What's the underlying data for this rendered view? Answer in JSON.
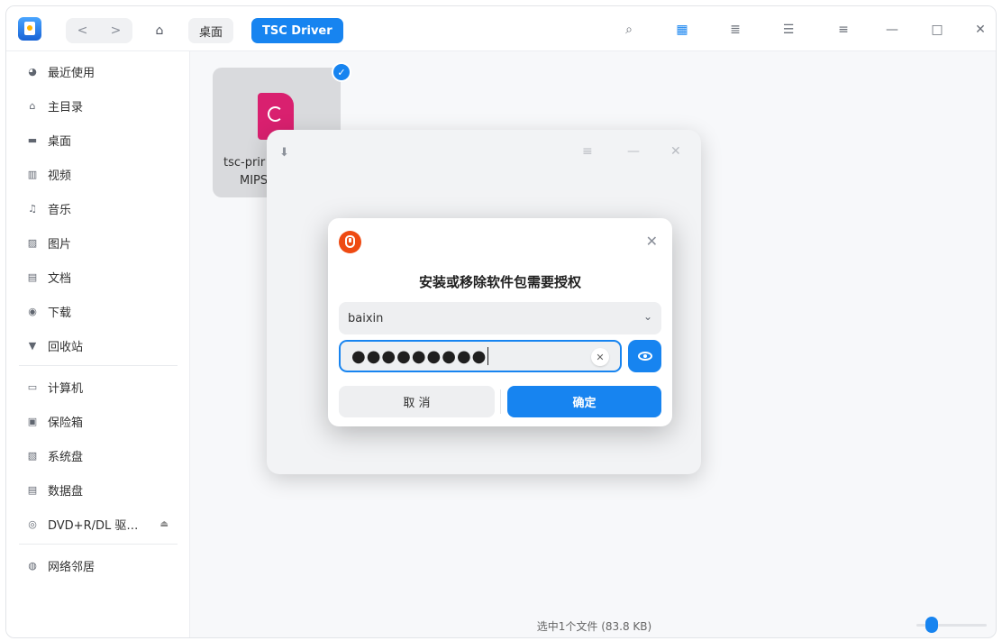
{
  "titlebar": {
    "back_icon": "<",
    "forward_icon": ">",
    "home_icon": "⌂",
    "breadcrumbs": [
      {
        "label": "桌面"
      },
      {
        "label": "TSC Driver"
      }
    ],
    "search_icon": "⌕",
    "icon_view_icon": "▦",
    "list_view_icon": "≣",
    "detail_view_icon": "☰",
    "menu_icon": "≡",
    "minimize_icon": "—",
    "maximize_icon": "□",
    "close_icon": "✕"
  },
  "sidebar": {
    "items": [
      {
        "label": "最近使用",
        "icon": "◕"
      },
      {
        "label": "主目录",
        "icon": "⌂"
      },
      {
        "label": "桌面",
        "icon": "▬"
      },
      {
        "label": "视频",
        "icon": "▥"
      },
      {
        "label": "音乐",
        "icon": "♫"
      },
      {
        "label": "图片",
        "icon": "▨"
      },
      {
        "label": "文档",
        "icon": "▤"
      },
      {
        "label": "下载",
        "icon": "◉"
      },
      {
        "label": "回收站",
        "icon": "▼"
      },
      {
        "label": "计算机",
        "icon": "▭"
      },
      {
        "label": "保险箱",
        "icon": "▣"
      },
      {
        "label": "系统盘",
        "icon": "▧"
      },
      {
        "label": "数据盘",
        "icon": "▤"
      },
      {
        "label": "DVD+R/DL 驱…",
        "icon": "◎"
      },
      {
        "label": "网络邻居",
        "icon": "◍"
      }
    ],
    "eject_icon": "⏏"
  },
  "content": {
    "file": {
      "name_line1": "tsc-prir",
      "name_line2": "MIPS",
      "check_icon": "✓"
    },
    "status": "选中1个文件 (83.8 KB)"
  },
  "installer": {
    "download_icon": "⬇",
    "menu_icon": "≡",
    "minimize_icon": "—",
    "close_icon": "✕"
  },
  "auth_dialog": {
    "title": "安装或移除软件包需要授权",
    "close_icon": "✕",
    "user": "baixin",
    "chevron": "⌄",
    "password_mask": "●●●●●●●●●",
    "clear_icon": "✕",
    "cancel_label": "取 消",
    "ok_label": "确定"
  },
  "colors": {
    "accent": "#1784f0",
    "warning_logo": "#ee4a12",
    "file_icon": "#d9206f"
  }
}
